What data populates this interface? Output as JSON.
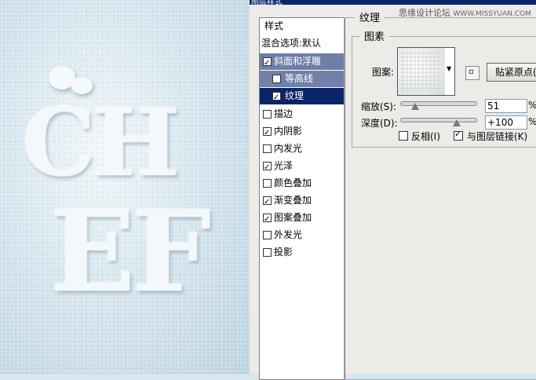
{
  "dialog": {
    "title": "图层样式",
    "watermark_cn": "思缘设计论坛",
    "watermark_site": "WWW.MISSYUAN.COM"
  },
  "canvas": {
    "line1": "CH",
    "line2": "EF"
  },
  "style_list": {
    "header": "样式",
    "blend_options": "混合选项:默认",
    "items": [
      {
        "label": "斜面和浮雕",
        "checked": true
      },
      {
        "label": "等高线",
        "checked": false
      },
      {
        "label": "纹理",
        "checked": true
      },
      {
        "label": "描边",
        "checked": false
      },
      {
        "label": "内阴影",
        "checked": true
      },
      {
        "label": "内发光",
        "checked": false
      },
      {
        "label": "光泽",
        "checked": true
      },
      {
        "label": "颜色叠加",
        "checked": false
      },
      {
        "label": "渐变叠加",
        "checked": true
      },
      {
        "label": "图案叠加",
        "checked": true
      },
      {
        "label": "外发光",
        "checked": false
      },
      {
        "label": "投影",
        "checked": false
      }
    ]
  },
  "texture": {
    "group_title": "纹理",
    "subgroup_title": "图素",
    "pattern_label": "图案:",
    "snap_button": "贴紧原点(A)",
    "scale_label": "缩放(S):",
    "scale_value": "51",
    "scale_fraction": 0.2,
    "depth_label": "深度(D):",
    "depth_value": "+100",
    "depth_fraction": 0.75,
    "percent": "%",
    "invert_label": "反相(I)",
    "invert_checked": false,
    "link_label": "与图层链接(K)",
    "link_checked": true
  }
}
